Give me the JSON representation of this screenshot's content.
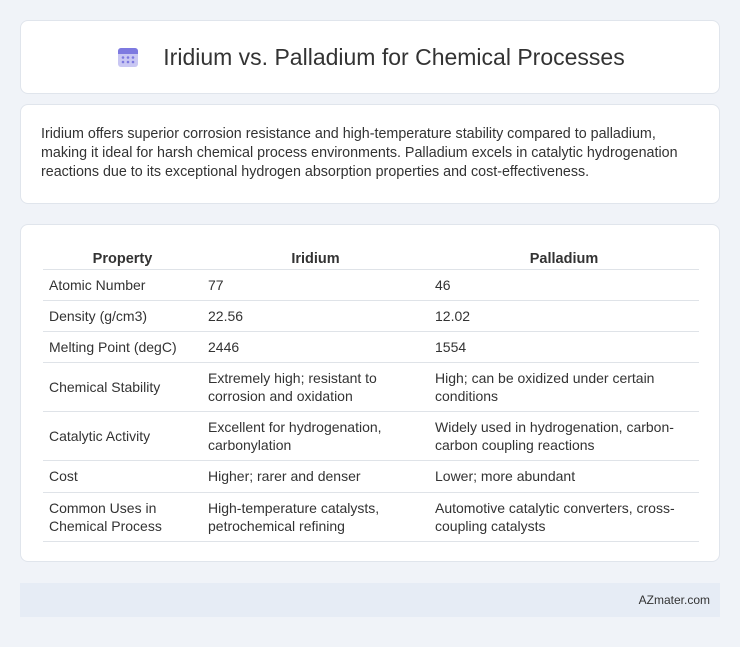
{
  "header": {
    "title": "Iridium vs. Palladium for Chemical Processes",
    "icon": "calendar-icon"
  },
  "summary": {
    "text": "Iridium offers superior corrosion resistance and high-temperature stability compared to palladium, making it ideal for harsh chemical process environments. Palladium excels in catalytic hydrogenation reactions due to its exceptional hydrogen absorption properties and cost-effectiveness."
  },
  "table": {
    "headers": [
      "Property",
      "Iridium",
      "Palladium"
    ],
    "rows": [
      [
        "Atomic Number",
        "77",
        "46"
      ],
      [
        "Density (g/cm3)",
        "22.56",
        "12.02"
      ],
      [
        "Melting Point (degC)",
        "2446",
        "1554"
      ],
      [
        "Chemical Stability",
        "Extremely high; resistant to corrosion and oxidation",
        "High; can be oxidized under certain conditions"
      ],
      [
        "Catalytic Activity",
        "Excellent for hydrogenation, carbonylation",
        "Widely used in hydrogenation, carbon-carbon coupling reactions"
      ],
      [
        "Cost",
        "Higher; rarer and denser",
        "Lower; more abundant"
      ],
      [
        "Common Uses in Chemical Process",
        "High-temperature catalysts, petrochemical refining",
        "Automotive catalytic converters, cross-coupling catalysts"
      ]
    ]
  },
  "footer": {
    "brand": "AZmater.com"
  },
  "colors": {
    "page_background": "#f0f3f8",
    "icon_accent": "#8a86e8",
    "footer_background": "#e6ecf5"
  }
}
